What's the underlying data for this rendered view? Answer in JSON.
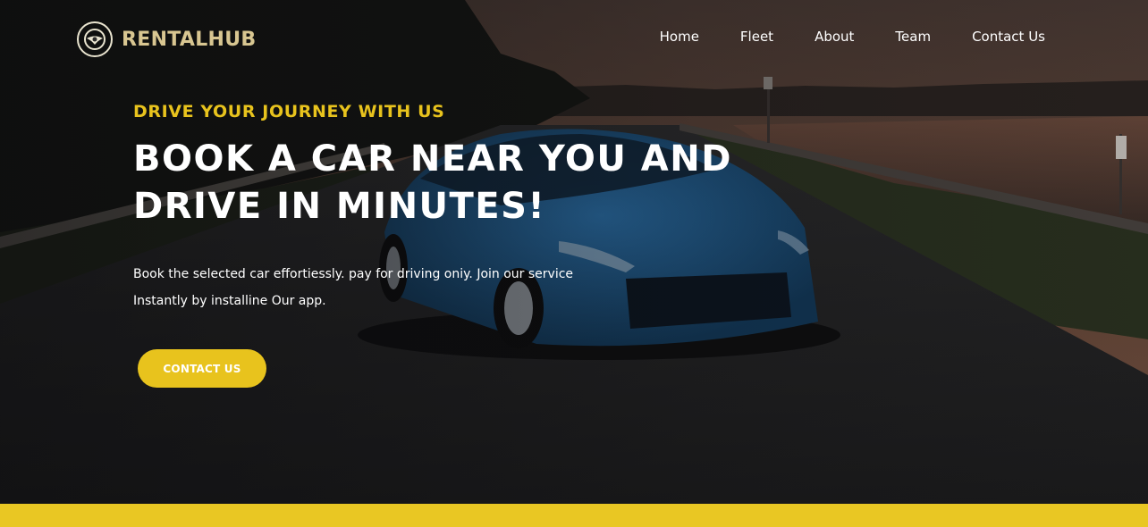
{
  "brand": {
    "name": "RENTALHUB",
    "logo_icon": "steering-wheel-icon"
  },
  "nav": {
    "items": [
      {
        "label": "Home"
      },
      {
        "label": "Fleet"
      },
      {
        "label": "About"
      },
      {
        "label": "Team"
      },
      {
        "label": "Contact Us"
      }
    ]
  },
  "hero": {
    "eyebrow": "DRIVE YOUR JOURNEY WITH US",
    "headline_line1": "BOOK A CAR NEAR YOU AND",
    "headline_line2": "DRIVE IN MINUTES!",
    "description_line1": "Book the selected car effortiessly. pay for driving oniy. Join our service",
    "description_line2": "Instantly by installine Our app.",
    "cta_label": "CONTACT US"
  },
  "colors": {
    "accent": "#e8c31d",
    "brand_text": "#d8c691",
    "text": "#ffffff"
  }
}
